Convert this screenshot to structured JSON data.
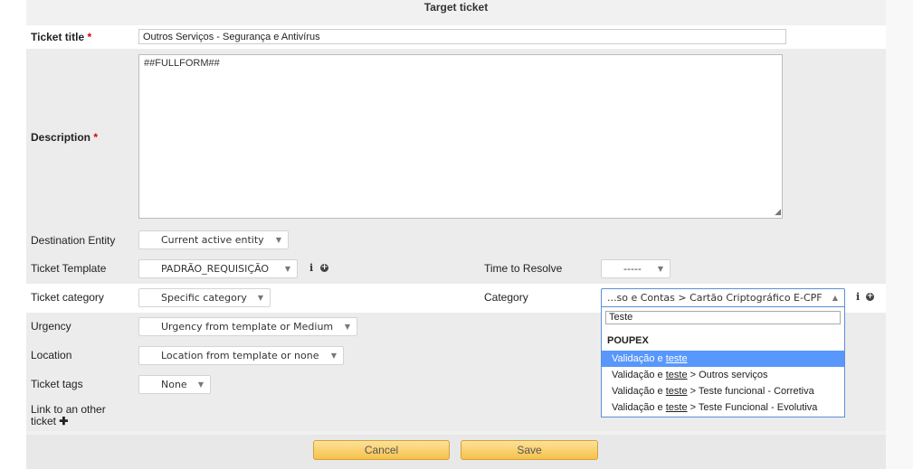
{
  "panel": {
    "title": "Target ticket"
  },
  "ticket_title": {
    "label": "Ticket title",
    "required": "*",
    "value": "Outros Serviços - Segurança e Antivírus"
  },
  "description": {
    "label": "Description",
    "required": "*",
    "value": "##FULLFORM##"
  },
  "destination_entity": {
    "label": "Destination Entity",
    "value": "Current active entity"
  },
  "ticket_template": {
    "label": "Ticket Template",
    "value": "PADRÃO_REQUISIÇÃO"
  },
  "time_to_resolve": {
    "label": "Time to Resolve",
    "value": "-----"
  },
  "ticket_category": {
    "label": "Ticket category",
    "value": "Specific category"
  },
  "category": {
    "label": "Category",
    "value": "...so e Contas > Cartão Criptográfico E-CPF",
    "search": "Teste",
    "group": "POUPEX",
    "options": [
      {
        "prefix": "Validação e ",
        "match": "teste",
        "suffix": ""
      },
      {
        "prefix": "Validação e ",
        "match": "teste",
        "suffix": " > Outros serviços"
      },
      {
        "prefix": "Validação e ",
        "match": "teste",
        "suffix": " > Teste funcional - Corretiva"
      },
      {
        "prefix": "Validação e ",
        "match": "teste",
        "suffix": " > Teste Funcional - Evolutiva"
      }
    ]
  },
  "urgency": {
    "label": "Urgency",
    "value": "Urgency from template or Medium"
  },
  "location": {
    "label": "Location",
    "value": "Location from template or none"
  },
  "ticket_tags": {
    "label": "Ticket tags",
    "value": "None"
  },
  "link_ticket": {
    "label_line1": "Link to an other",
    "label_line2": "ticket"
  },
  "icons": {
    "info": "i",
    "add": "+",
    "dropdown_closed": "▼",
    "dropdown_open": "▲",
    "plus_bold": "✚"
  },
  "buttons": {
    "cancel": "Cancel",
    "save": "Save"
  },
  "colors": {
    "highlight": "#5897fb",
    "button": "#f6c24a",
    "required": "#dd0000"
  }
}
